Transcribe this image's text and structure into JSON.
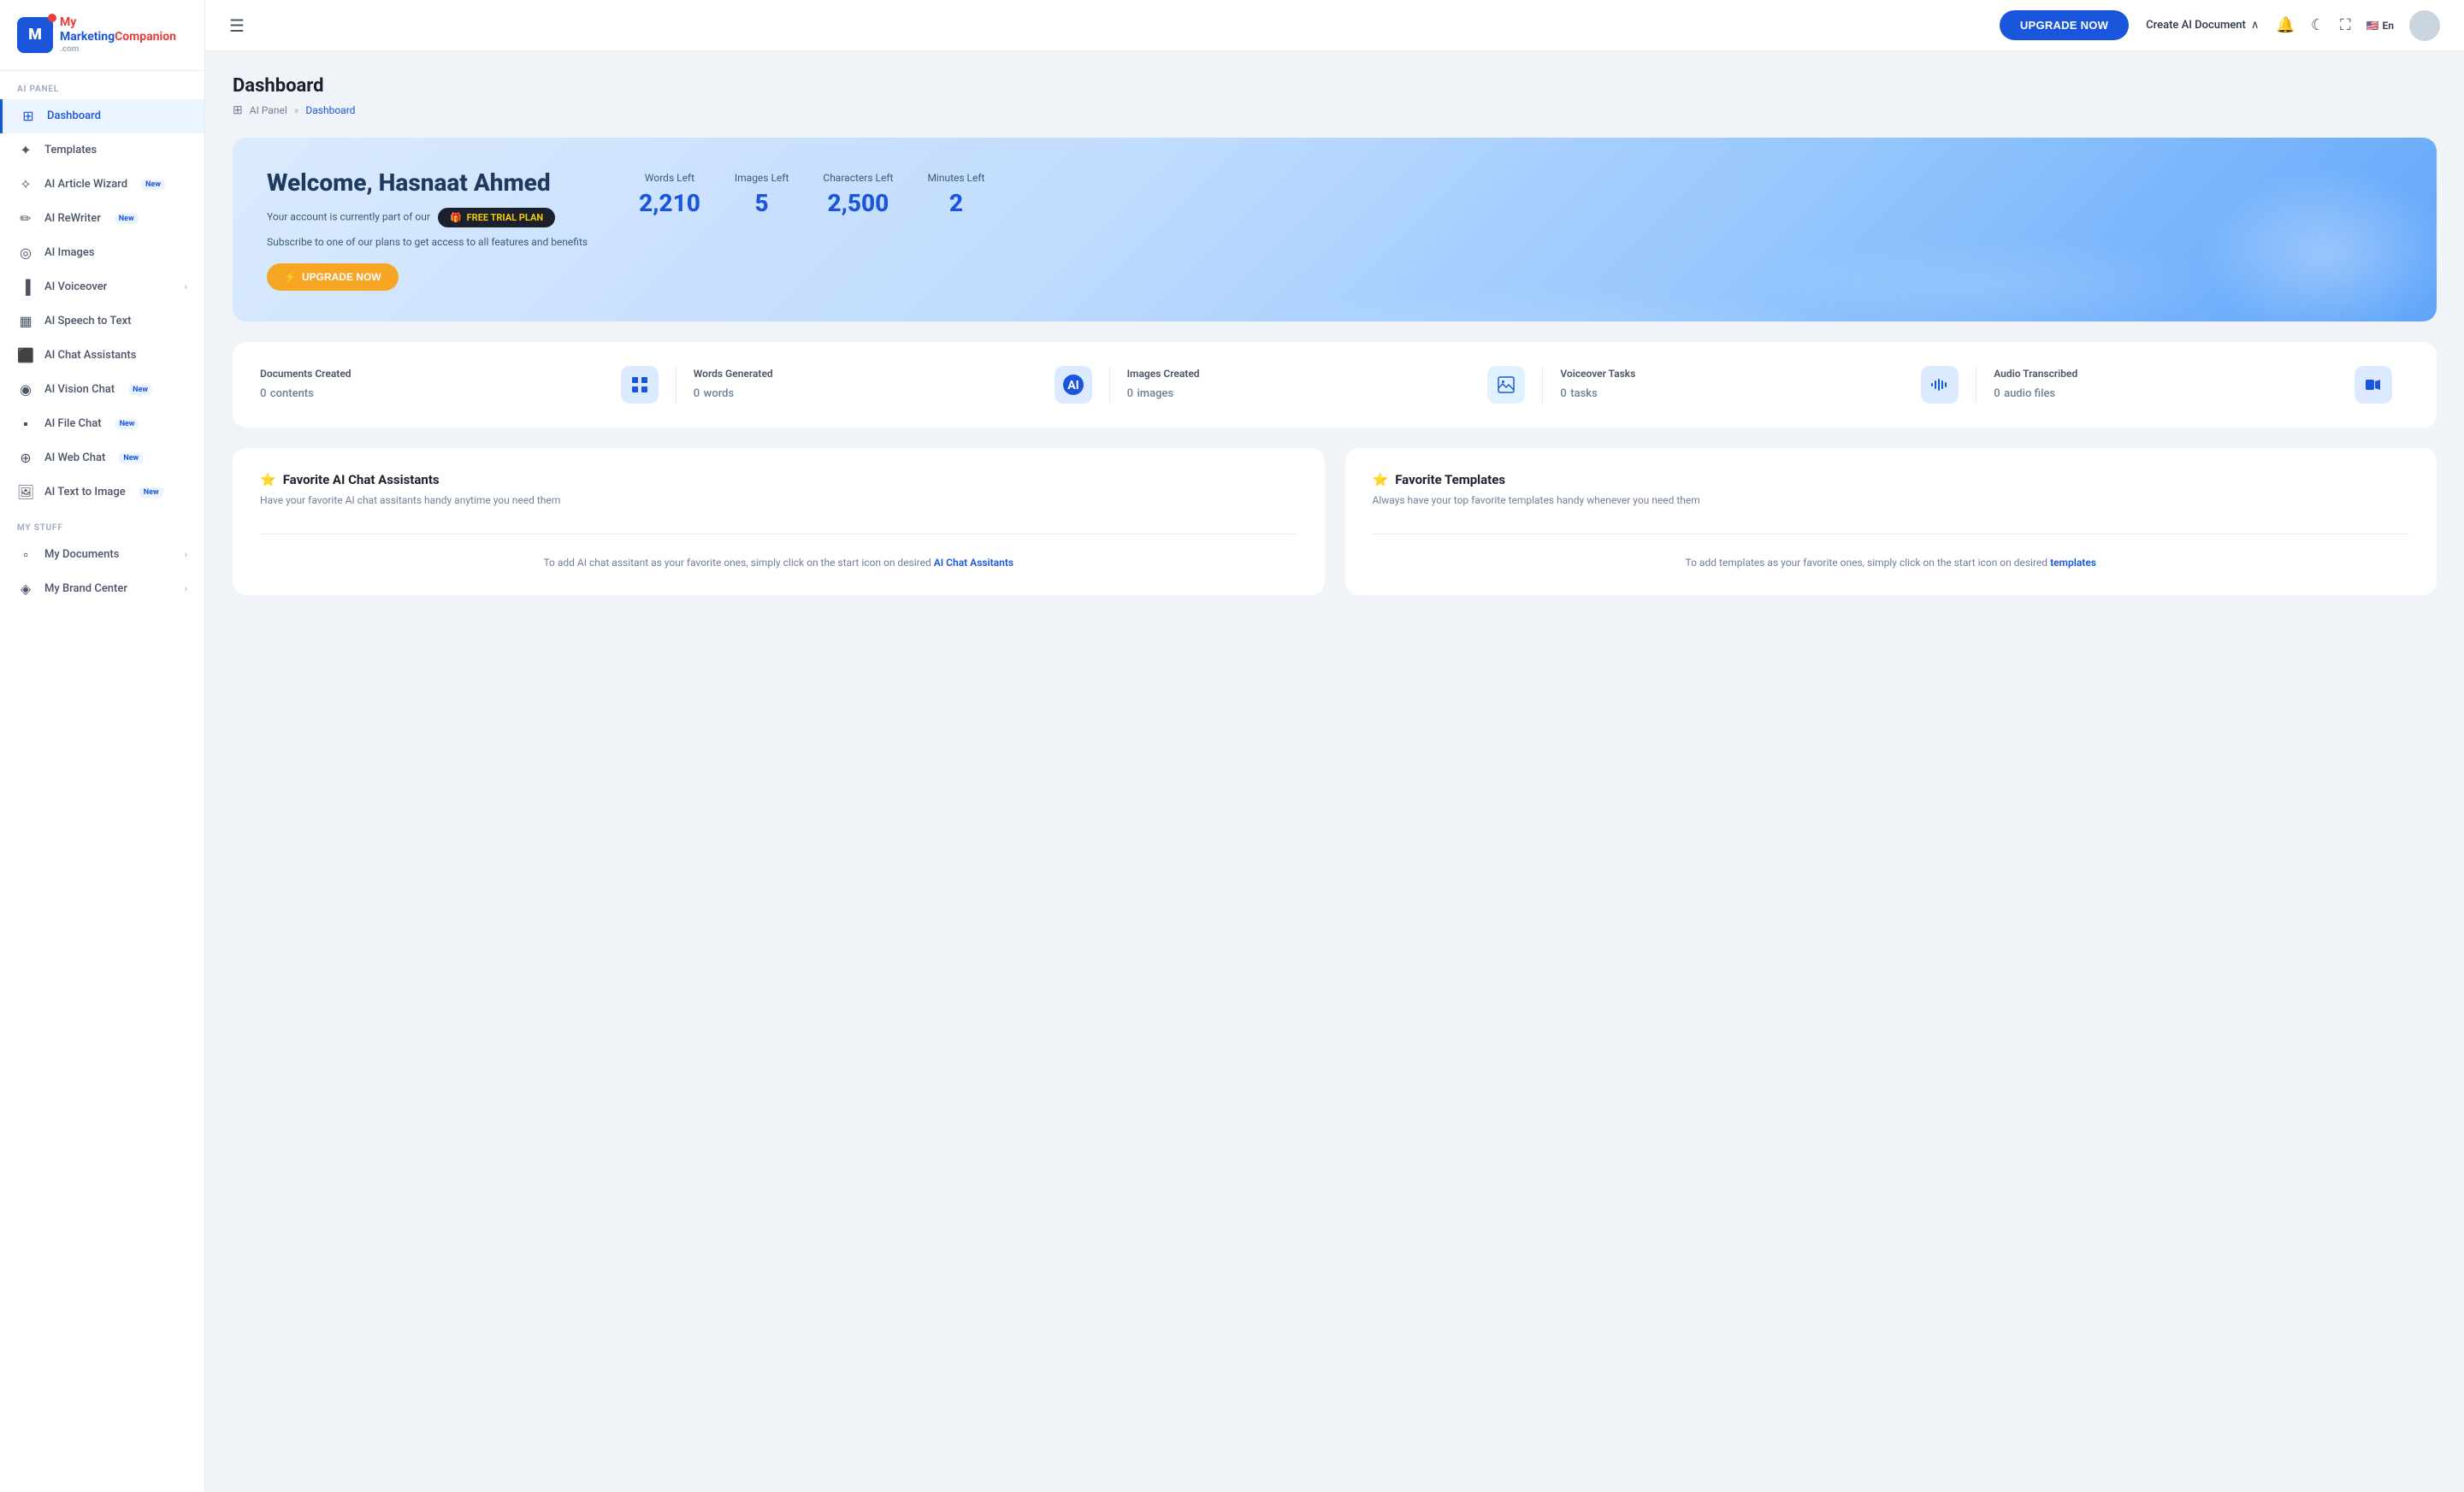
{
  "sidebar": {
    "logo": {
      "letter": "M",
      "text_my": "My",
      "text_marketing": "Marketing",
      "text_companion": "Companion",
      "text_domain": ".com"
    },
    "section_ai": "AI PANEL",
    "section_my": "MY STUFF",
    "items_ai": [
      {
        "id": "dashboard",
        "label": "Dashboard",
        "icon": "⊞",
        "active": true,
        "badge": "",
        "chevron": false
      },
      {
        "id": "templates",
        "label": "Templates",
        "icon": "✦",
        "active": false,
        "badge": "",
        "chevron": false
      },
      {
        "id": "ai-article-wizard",
        "label": "AI Article Wizard",
        "icon": "✧",
        "active": false,
        "badge": "New",
        "chevron": false
      },
      {
        "id": "ai-rewriter",
        "label": "AI ReWriter",
        "icon": "✏",
        "active": false,
        "badge": "New",
        "chevron": false
      },
      {
        "id": "ai-images",
        "label": "AI Images",
        "icon": "◎",
        "active": false,
        "badge": "",
        "chevron": false
      },
      {
        "id": "ai-voiceover",
        "label": "AI Voiceover",
        "icon": "▐",
        "active": false,
        "badge": "",
        "chevron": true
      },
      {
        "id": "ai-speech-to-text",
        "label": "AI Speech to Text",
        "icon": "▦",
        "active": false,
        "badge": "",
        "chevron": false
      },
      {
        "id": "ai-chat-assistants",
        "label": "AI Chat Assistants",
        "icon": "⬜",
        "active": false,
        "badge": "",
        "chevron": false
      },
      {
        "id": "ai-vision-chat",
        "label": "AI Vision Chat",
        "icon": "◉",
        "active": false,
        "badge": "New",
        "chevron": false
      },
      {
        "id": "ai-file-chat",
        "label": "AI File Chat",
        "icon": "▪",
        "active": false,
        "badge": "New",
        "chevron": false
      },
      {
        "id": "ai-web-chat",
        "label": "AI Web Chat",
        "icon": "⊕",
        "active": false,
        "badge": "New",
        "chevron": false
      },
      {
        "id": "ai-text-to-image",
        "label": "AI Text to Image",
        "icon": "🖼",
        "active": false,
        "badge": "New",
        "chevron": false
      }
    ],
    "items_my": [
      {
        "id": "my-documents",
        "label": "My Documents",
        "icon": "▫",
        "active": false,
        "badge": "",
        "chevron": true
      },
      {
        "id": "my-brand-center",
        "label": "My Brand Center",
        "icon": "◈",
        "active": false,
        "badge": "",
        "chevron": true
      }
    ]
  },
  "header": {
    "upgrade_label": "UPGRADE NOW",
    "create_ai_label": "Create AI Document",
    "lang": "En"
  },
  "page": {
    "title": "Dashboard",
    "breadcrumb_panel": "AI Panel",
    "breadcrumb_current": "Dashboard"
  },
  "welcome": {
    "greeting": "Welcome, Hasnaat Ahmed",
    "account_text": "Your account is currently part of our",
    "plan_badge": "FREE TRIAL PLAN",
    "subscribe_text": "Subscribe to one of our plans to get access to all features and benefits",
    "upgrade_btn": "UPGRADE NOW",
    "stats": [
      {
        "label": "Words Left",
        "value": "2,210"
      },
      {
        "label": "Images Left",
        "value": "5"
      },
      {
        "label": "Characters Left",
        "value": "2,500"
      },
      {
        "label": "Minutes Left",
        "value": "2"
      }
    ]
  },
  "usage_stats": [
    {
      "title": "Documents Created",
      "value": "0",
      "unit": "contents",
      "icon": "⊡"
    },
    {
      "title": "Words Generated",
      "value": "0",
      "unit": "words",
      "icon": "🤖"
    },
    {
      "title": "Images Created",
      "value": "0",
      "unit": "images",
      "icon": "🏔"
    },
    {
      "title": "Voiceover Tasks",
      "value": "0",
      "unit": "tasks",
      "icon": "📊"
    },
    {
      "title": "Audio Transcribed",
      "value": "0",
      "unit": "audio files",
      "icon": "🎵"
    }
  ],
  "favorite_sections": [
    {
      "id": "chat-assistants",
      "title": "Favorite AI Chat Assistants",
      "subtitle": "Have your favorite AI chat assitants handy anytime you need them",
      "empty_text": "To add AI chat assitant as your favorite ones, simply click on the start icon on desired",
      "empty_link_text": "AI Chat Assitants",
      "empty_link": "#"
    },
    {
      "id": "templates",
      "title": "Favorite Templates",
      "subtitle": "Always have your top favorite templates handy whenever you need them",
      "empty_text": "To add templates as your favorite ones, simply click on the start icon on desired",
      "empty_link_text": "templates",
      "empty_link": "#"
    }
  ]
}
